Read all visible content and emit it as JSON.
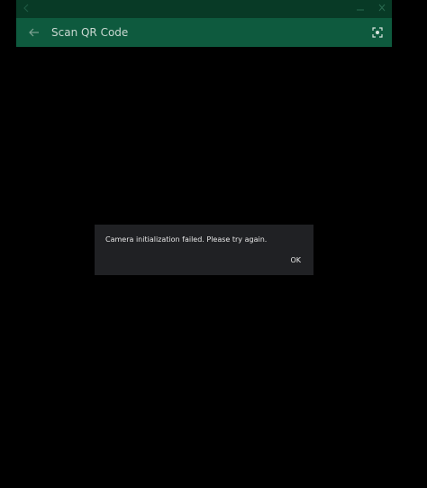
{
  "colors": {
    "background": "#000000",
    "titlebar": "#083a26",
    "appbar": "#0e5a3e",
    "title_text": "#c9d8d1",
    "dialog_bg": "#202124",
    "dialog_text": "#e6e6e6"
  },
  "titlebar": {
    "back_icon": "arrow-left-icon",
    "minimize_icon": "minimize-icon",
    "close_icon": "close-icon"
  },
  "appbar": {
    "title": "Scan QR Code",
    "back_icon": "arrow-left-icon",
    "scan_icon": "qr-scan-icon"
  },
  "dialog": {
    "message": "Camera initialization failed. Please try again.",
    "ok_label": "OK"
  }
}
